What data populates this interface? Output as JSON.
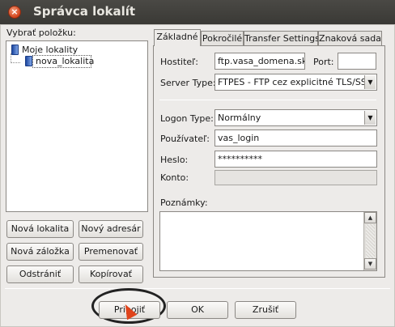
{
  "window": {
    "title": "Správca lokalít"
  },
  "left": {
    "label": "Vybrať položku:",
    "tree": [
      {
        "label": "Moje lokality"
      },
      {
        "label": "nova_lokalita"
      }
    ],
    "buttons": {
      "new_site": "Nová lokalita",
      "new_address": "Nový adresár",
      "new_bookmark": "Nová záložka",
      "rename": "Premenovať",
      "delete": "Odstrániť",
      "copy": "Kopírovať"
    }
  },
  "tabs": [
    "Základné",
    "Pokročilé",
    "Transfer Settings",
    "Znaková sada"
  ],
  "form": {
    "host_label": "Hostiteľ:",
    "host_value": "ftp.vasa_domena.sk",
    "port_label": "Port:",
    "port_value": "",
    "server_type_label": "Server Type:",
    "server_type_value": "FTPES - FTP cez explicitné TLS/SSL",
    "logon_type_label": "Logon Type:",
    "logon_type_value": "Normálny",
    "user_label": "Používateľ:",
    "user_value": "vas_login",
    "password_label": "Heslo:",
    "password_value": "**********",
    "account_label": "Konto:",
    "account_value": "",
    "notes_label": "Poznámky:",
    "notes_value": ""
  },
  "footer": {
    "connect": "Pripojiť",
    "ok": "OK",
    "cancel": "Zrušiť"
  },
  "icons": {
    "close": "close-icon",
    "site_manager": "computer-icon",
    "dropdown": "chevron-down-icon"
  },
  "colors": {
    "titlebar": "#3f3e3a",
    "close": "#e0531f",
    "dialog": "#edebe9",
    "cursor": "#e0441c"
  }
}
